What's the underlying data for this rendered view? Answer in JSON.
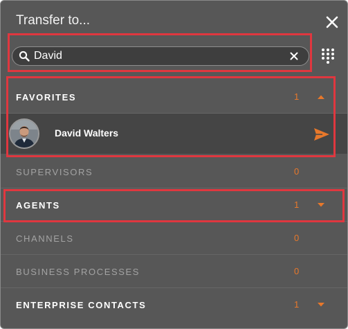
{
  "header": {
    "title": "Transfer to...",
    "close_icon": "close-icon"
  },
  "search": {
    "value": "David",
    "search_icon": "search-icon",
    "clear_icon": "clear-icon",
    "dialpad_icon": "dialpad-icon"
  },
  "sections": [
    {
      "label": "FAVORITES",
      "count": "1",
      "expanded": true,
      "active": true
    },
    {
      "label": "SUPERVISORS",
      "count": "0",
      "expanded": false,
      "active": false
    },
    {
      "label": "AGENTS",
      "count": "1",
      "expanded": false,
      "active": true
    },
    {
      "label": "CHANNELS",
      "count": "0",
      "expanded": false,
      "active": false
    },
    {
      "label": "BUSINESS PROCESSES",
      "count": "0",
      "expanded": false,
      "active": false
    },
    {
      "label": "ENTERPRISE CONTACTS",
      "count": "1",
      "expanded": false,
      "active": true
    }
  ],
  "favorites": [
    {
      "name": "David Walters",
      "avatar_icon": "avatar-photo",
      "action_icon": "send-icon"
    }
  ],
  "colors": {
    "panel_bg": "#575757",
    "selected_row_bg": "#454545",
    "accent": "#e8782b",
    "dim_text": "#a3a3a3",
    "highlight_box": "#e0373f"
  }
}
